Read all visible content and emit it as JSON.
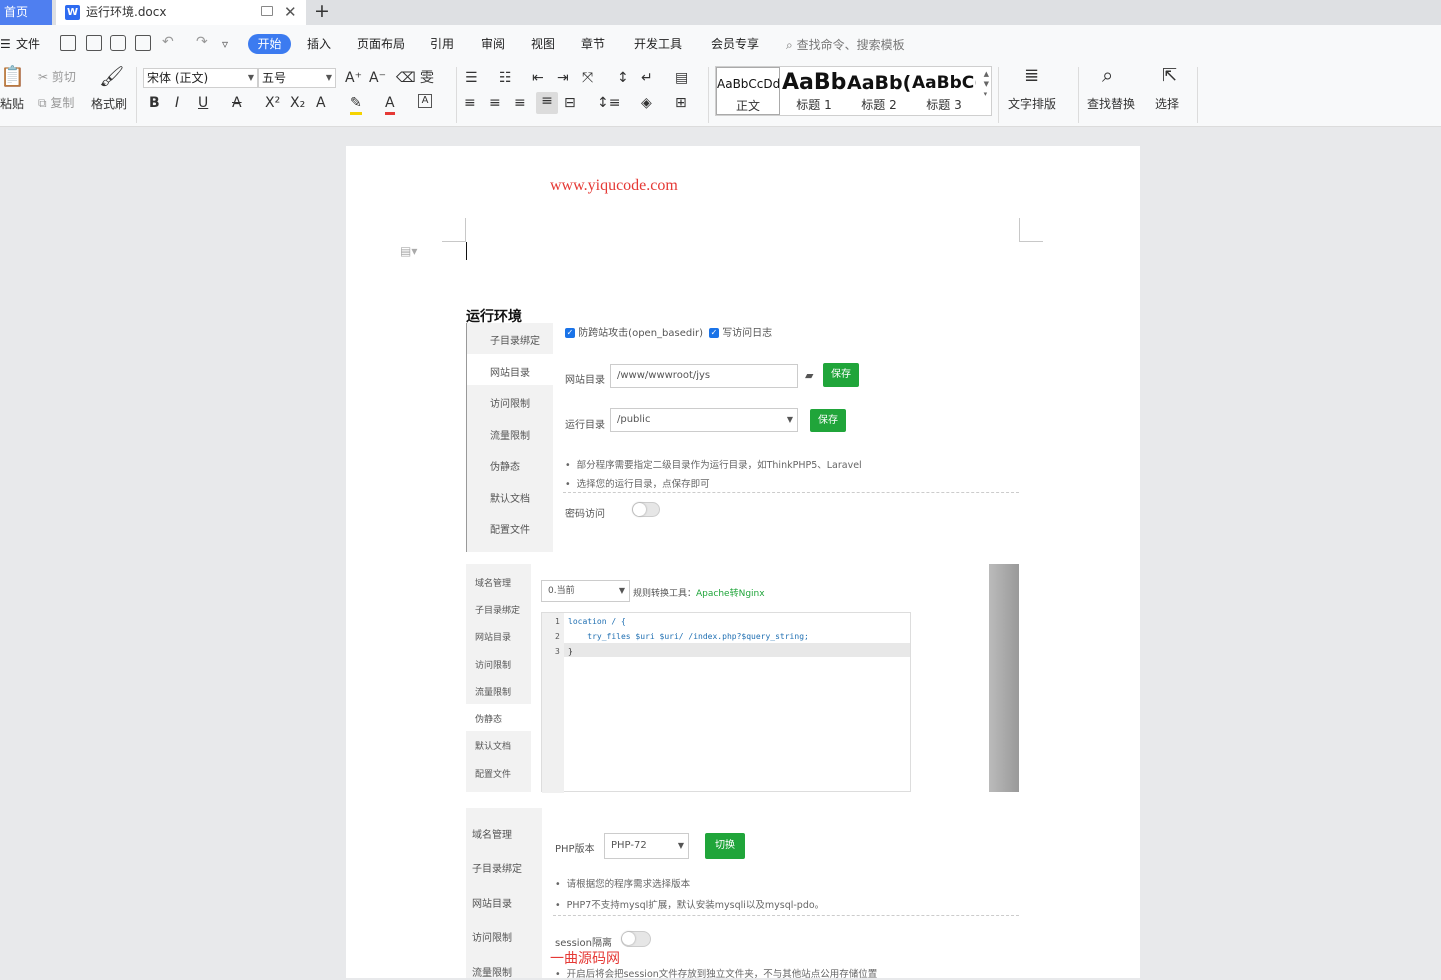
{
  "tabs": {
    "home": "首页",
    "document": "运行环境.docx",
    "add": "+",
    "close": "✕"
  },
  "menu": {
    "file": "文件",
    "start": "开始",
    "insert": "插入",
    "layout": "页面布局",
    "references": "引用",
    "review": "审阅",
    "view": "视图",
    "chapter": "章节",
    "devtools": "开发工具",
    "vip": "会员专享",
    "search_placeholder": "查找命令、搜索模板"
  },
  "ribbon": {
    "paste": "粘贴",
    "cut": "剪切",
    "copy": "复制",
    "format_painter": "格式刷",
    "font_name": "宋体 (正文)",
    "font_size": "五号",
    "text_layout": "文字排版",
    "find_replace": "查找替换",
    "select": "选择",
    "styles": [
      {
        "preview": "AaBbCcDd",
        "name": "正文"
      },
      {
        "preview": "AaBb",
        "name": "标题 1"
      },
      {
        "preview": "AaBb(",
        "name": "标题 2"
      },
      {
        "preview": "AaBbC(",
        "name": "标题 3"
      }
    ]
  },
  "document": {
    "watermark_top": "www.yiqucode.com",
    "heading": "运行环境",
    "watermark_bottom": "一曲源码网"
  },
  "shot1": {
    "sidebar": [
      "子目录绑定",
      "网站目录",
      "访问限制",
      "流量限制",
      "伪静态",
      "默认文档",
      "配置文件"
    ],
    "check1": "防跨站攻击(open_basedir)",
    "check2": "写访问日志",
    "site_dir_label": "网站目录",
    "site_dir_value": "/www/wwwroot/jys",
    "save": "保存",
    "run_dir_label": "运行目录",
    "run_dir_value": "/public",
    "tips": [
      "部分程序需要指定二级目录作为运行目录，如ThinkPHP5、Laravel",
      "选择您的运行目录，点保存即可"
    ],
    "password_access": "密码访问"
  },
  "shot2": {
    "sidebar": [
      "域名管理",
      "子目录绑定",
      "网站目录",
      "访问限制",
      "流量限制",
      "伪静态",
      "默认文档",
      "配置文件"
    ],
    "select_value": "0.当前",
    "rule_tool_label": "规则转换工具：",
    "rule_tool_link": "Apache转Nginx",
    "code_lines": [
      "location / {",
      "    try_files $uri $uri/ /index.php?$query_string;",
      "}"
    ],
    "line_numbers": [
      "1",
      "2",
      "3"
    ]
  },
  "shot3": {
    "sidebar": [
      "域名管理",
      "子目录绑定",
      "网站目录",
      "访问限制",
      "流量限制"
    ],
    "php_label": "PHP版本",
    "php_value": "PHP-72",
    "switch": "切换",
    "tips": [
      "请根据您的程序需求选择版本",
      "PHP7不支持mysql扩展，默认安装mysqli以及mysql-pdo。"
    ],
    "session_label": "session隔离",
    "cut_tip": "开启后将会把session文件存放到独立文件夹，不与其他站点公用存储位置"
  }
}
